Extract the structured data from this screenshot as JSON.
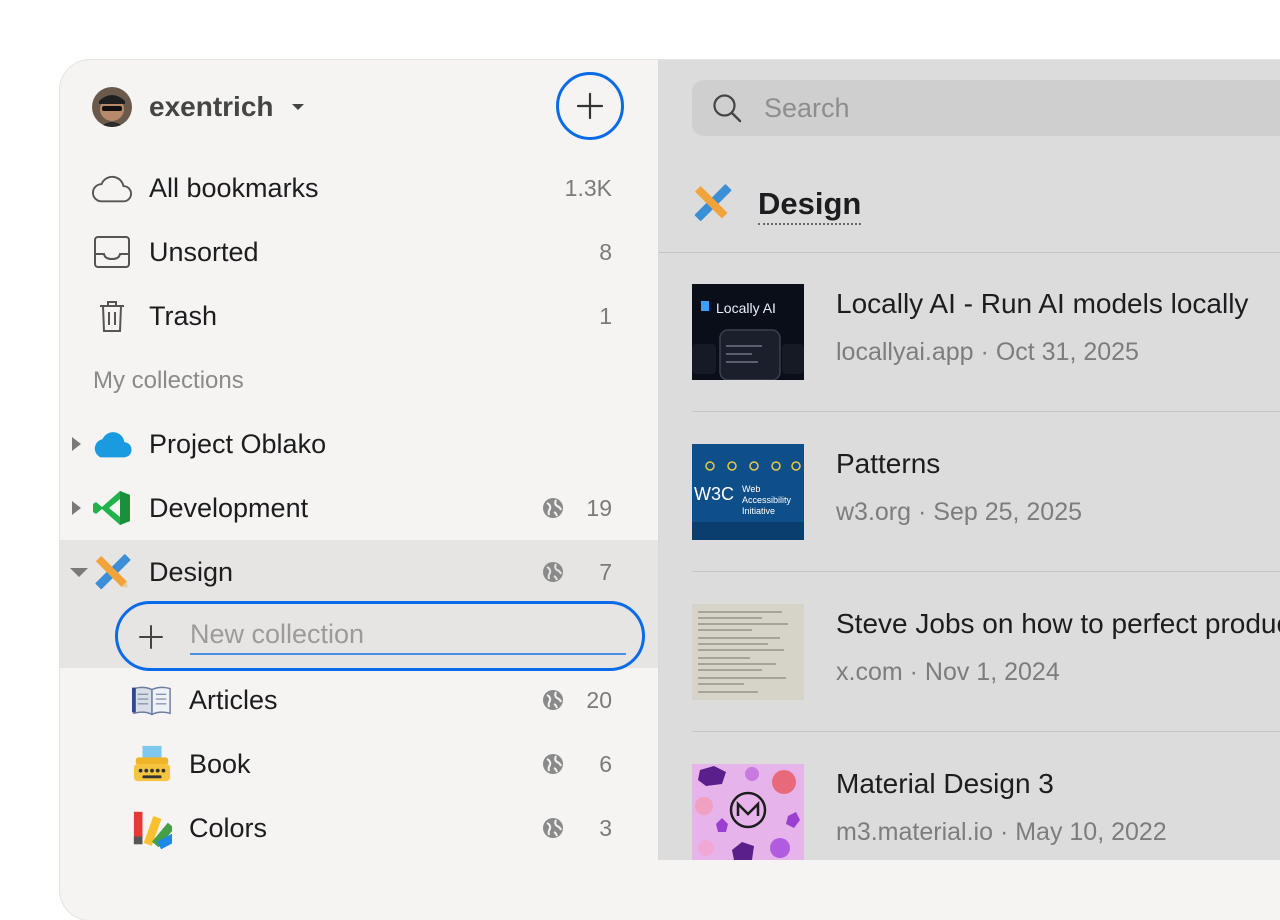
{
  "user": {
    "name": "exentrich"
  },
  "system": [
    {
      "label": "All bookmarks",
      "count": "1.3K",
      "icon": "cloud-icon"
    },
    {
      "label": "Unsorted",
      "count": "8",
      "icon": "inbox-icon"
    },
    {
      "label": "Trash",
      "count": "1",
      "icon": "trash-icon"
    }
  ],
  "collections_title": "My collections",
  "collections": [
    {
      "label": "Project Oblako",
      "count": ""
    },
    {
      "label": "Development",
      "count": "19"
    },
    {
      "label": "Design",
      "count": "7"
    }
  ],
  "new_collection": {
    "placeholder": "New collection"
  },
  "subcollections": [
    {
      "label": "Articles",
      "count": "20"
    },
    {
      "label": "Book",
      "count": "6"
    },
    {
      "label": "Colors",
      "count": "3"
    }
  ],
  "search": {
    "placeholder": "Search"
  },
  "current_collection": {
    "title": "Design"
  },
  "bookmarks": [
    {
      "title": "Locally AI - Run AI models locally",
      "domain": "locallyai.app",
      "date": "Oct 31, 2025",
      "thumb_text": "Locally AI"
    },
    {
      "title": "Patterns",
      "domain": "w3.org",
      "date": "Sep 25, 2025",
      "thumb_text": "Web Accessibility Initiative"
    },
    {
      "title": "Steve Jobs on how to perfect products",
      "domain": "x.com",
      "date": "Nov 1, 2024",
      "thumb_text": ""
    },
    {
      "title": "Material Design 3",
      "domain": "m3.material.io",
      "date": "May 10, 2022",
      "thumb_text": ""
    }
  ],
  "colors": {
    "accent": "#0a6be8",
    "sidebar_bg": "#f5f4f2",
    "main_bg": "#dcdcdc"
  }
}
